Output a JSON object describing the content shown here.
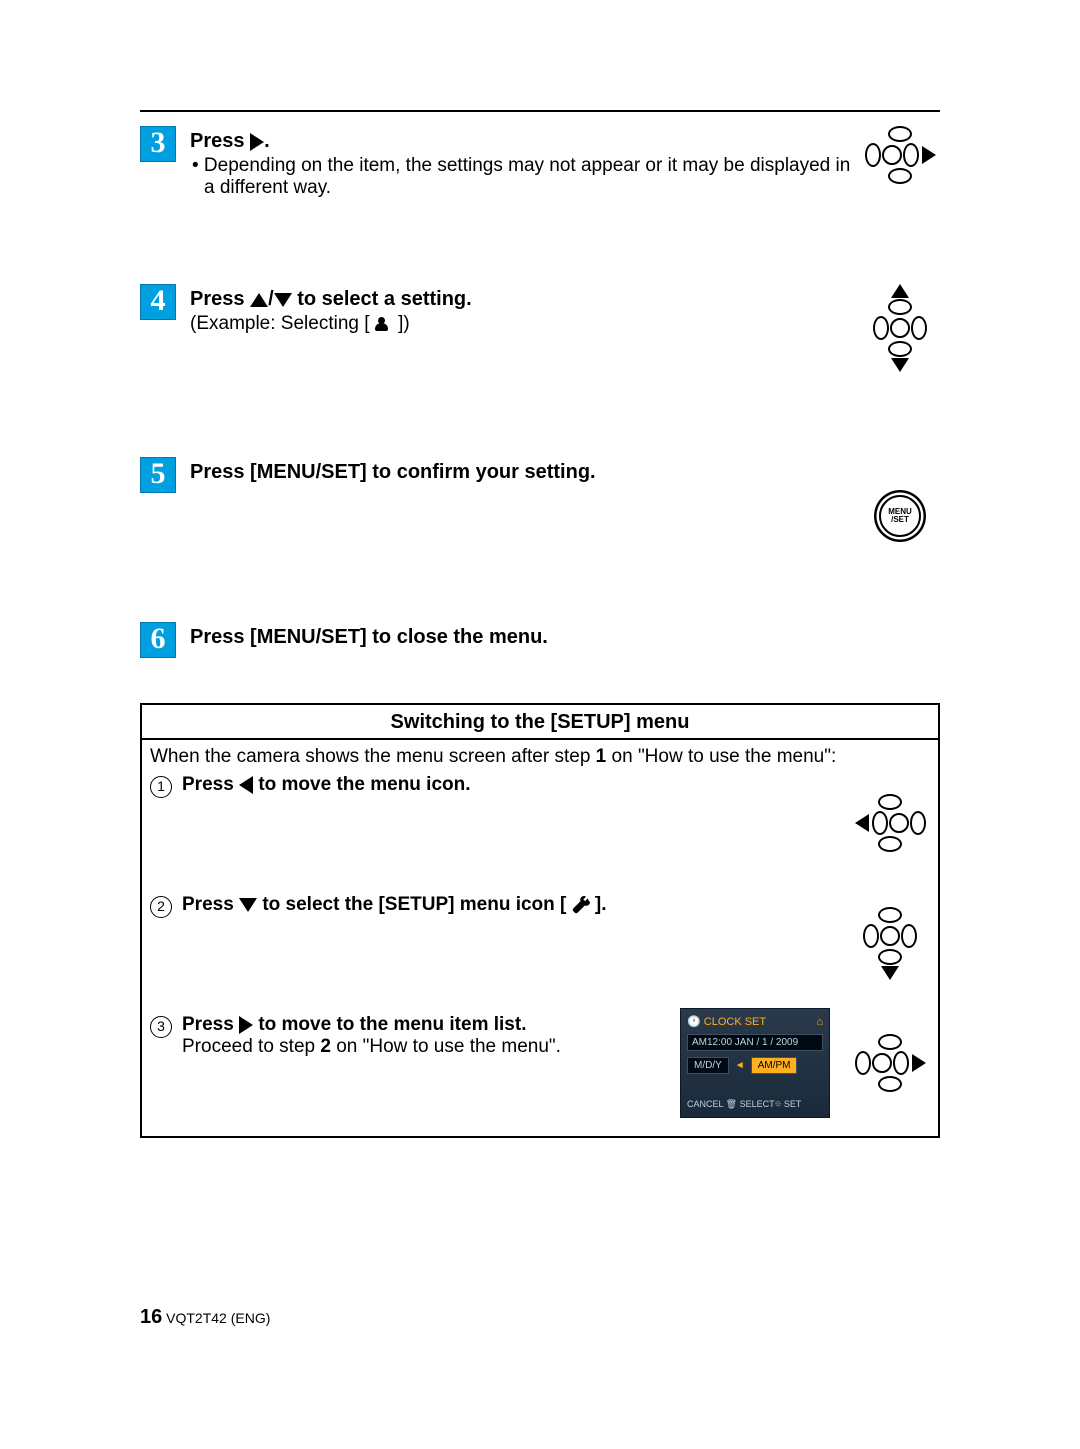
{
  "step3": {
    "num": "3",
    "title_prefix": "Press ",
    "title_suffix": ".",
    "bullet": "• Depending on the item, the settings may not appear or it may be displayed in a different way."
  },
  "step4": {
    "num": "4",
    "title_prefix": "Press ",
    "title_mid": "/",
    "title_suffix": " to select a setting.",
    "example_prefix": "(Example: Selecting [ ",
    "example_suffix": " ])"
  },
  "step5": {
    "num": "5",
    "title": "Press [MENU/SET] to confirm your setting."
  },
  "step6": {
    "num": "6",
    "title": "Press [MENU/SET] to close the menu."
  },
  "menuset_label_top": "MENU",
  "menuset_label_bot": "/SET",
  "boxed": {
    "title": "Switching to the [SETUP] menu",
    "intro_a": "When the camera shows the menu screen after step ",
    "intro_step": "1",
    "intro_b": " on \"How to use the menu\":",
    "sub1": {
      "num": "1",
      "title_prefix": "Press ",
      "title_suffix": " to move the menu icon."
    },
    "sub2": {
      "num": "2",
      "title_prefix": "Press ",
      "title_mid": " to select the [SETUP] menu icon [ ",
      "title_suffix": " ]."
    },
    "sub3": {
      "num": "3",
      "title_prefix": "Press ",
      "title_suffix": " to move to the menu item list.",
      "body_a": "Proceed to step ",
      "body_step": "2",
      "body_b": " on \"How to use the menu\"."
    }
  },
  "shot": {
    "title": "CLOCK SET",
    "time": "AM12:00  JAN /  1 / 2009",
    "fmt1": "M/D/Y",
    "fmt2": "AM/PM",
    "foot": "CANCEL 🗑 SELECT⯐  SET"
  },
  "footer": {
    "page": "16",
    "code": "VQT2T42 (ENG)"
  }
}
